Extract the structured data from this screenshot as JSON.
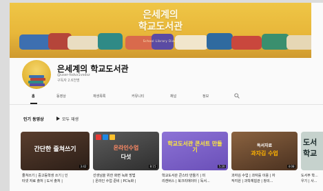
{
  "banner": {
    "title_line1": "은세계의",
    "title_line2": "학교도서관",
    "subtitle": "School Library Diary"
  },
  "channel": {
    "name": "은세계의 학교도서관",
    "handle": "@user-fsdvz1vsdsz",
    "subscribers": "구독자 2.6천명"
  },
  "tabs": [
    "홈",
    "동영상",
    "재생목록",
    "커뮤니티",
    "채널",
    "정보"
  ],
  "section": {
    "title": "인기 동영상",
    "play_all": "모두 재생"
  },
  "videos": [
    {
      "thumb_line1": "간단한 줄쳐쓰기",
      "thumb_line2": "",
      "duration": "3:42",
      "caption_line1": "줄쳐쓰기 | 중고등학생 쓰기 | 인",
      "caption_line2": "터넷 자료 출처 | 도서 출처 |"
    },
    {
      "thumb_line1": "온라인수업",
      "thumb_line2": "다섯",
      "duration": "8:15",
      "caption_line1": "선생님을 위한 화면 녹화 방법",
      "caption_line2": "| 온라인 수업 준비 | PC녹화 |"
    },
    {
      "thumb_line1": "학교도서관 콘서트 만들기",
      "thumb_line2": "",
      "duration": "5:20",
      "caption_line1": "학교도서관 콘스타 만들기 | 미",
      "caption_line2": "리캔버스 | 북크리에이터 | 독서..."
    },
    {
      "thumb_line1": "독서자료",
      "thumb_line2": "과자김 수업",
      "duration": "4:08",
      "caption_line1": "과자김 수업 | 과자를 이용 | 자",
      "caption_line2": "작지원 | 과학체험관 | 창의..."
    },
    {
      "thumb_line1": "도서",
      "thumb_line2": "학교",
      "duration": "",
      "caption_line1": "도서부 학...",
      "caption_line2": "우기 | 사..."
    }
  ],
  "colors": {
    "banner": "#e8b73a",
    "thumb1": "#3c2b22",
    "thumb2": "#4b4b4b",
    "thumb3": "#7a5fc7",
    "thumb4": "#6d4b2e",
    "thumb5": "#bcc9c4"
  }
}
